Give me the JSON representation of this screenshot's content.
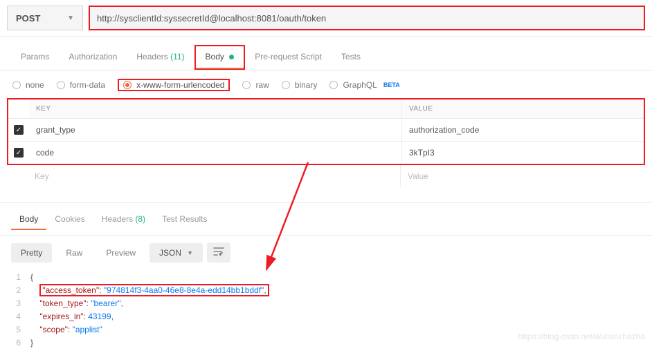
{
  "request": {
    "method": "POST",
    "url": "http://sysclientId:syssecretId@localhost:8081/oauth/token"
  },
  "reqTabs": {
    "params": "Params",
    "authorization": "Authorization",
    "headers": "Headers",
    "headersCount": "(11)",
    "body": "Body",
    "prescript": "Pre-request Script",
    "tests": "Tests"
  },
  "bodyTypes": {
    "none": "none",
    "formdata": "form-data",
    "urlencoded": "x-www-form-urlencoded",
    "raw": "raw",
    "binary": "binary",
    "graphql": "GraphQL",
    "beta": "BETA"
  },
  "kvHeader": {
    "key": "KEY",
    "value": "VALUE"
  },
  "kvRows": [
    {
      "key": "grant_type",
      "value": "authorization_code"
    },
    {
      "key": "code",
      "value": "3kTpI3"
    }
  ],
  "kvPlaceholder": {
    "key": "Key",
    "value": "Value"
  },
  "respTabs": {
    "body": "Body",
    "cookies": "Cookies",
    "headers": "Headers",
    "headersCount": "(8)",
    "tests": "Test Results"
  },
  "toolbar": {
    "pretty": "Pretty",
    "raw": "Raw",
    "preview": "Preview",
    "json": "JSON"
  },
  "response": {
    "l1": "{",
    "l2k": "\"access_token\"",
    "l2v": "\"974814f3-4aa0-46e8-8e4a-edd14bb1bddf\"",
    "l3k": "\"token_type\"",
    "l3v": "\"bearer\"",
    "l4k": "\"expires_in\"",
    "l4v": "43199",
    "l5k": "\"scope\"",
    "l5v": "\"applist\"",
    "l6": "}"
  },
  "lineNums": {
    "n1": "1",
    "n2": "2",
    "n3": "3",
    "n4": "4",
    "n5": "5",
    "n6": "6"
  },
  "watermark": "https://blog.csdn.net/wulianzhazha",
  "chart_data": null
}
